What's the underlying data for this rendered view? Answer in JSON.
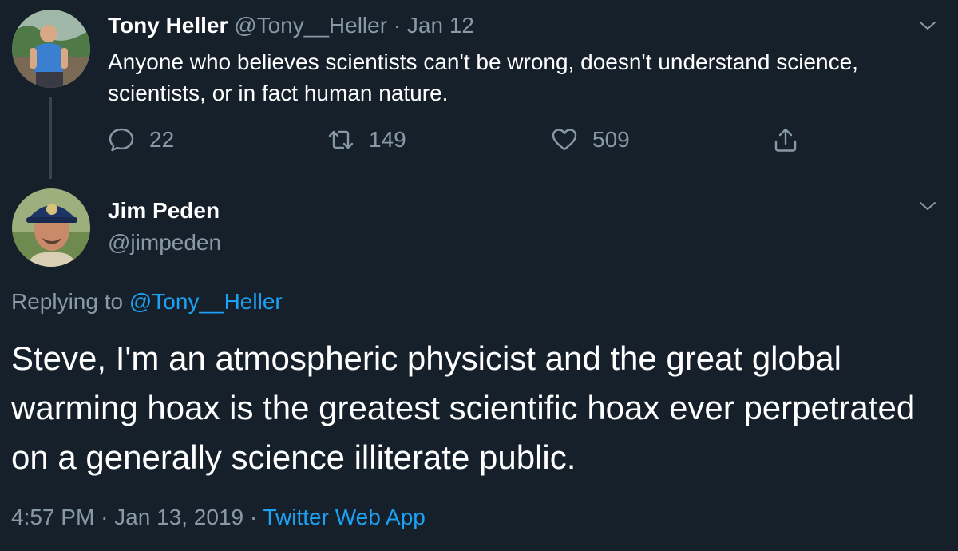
{
  "tweet1": {
    "author_name": "Tony Heller",
    "handle": "@Tony__Heller",
    "separator": "·",
    "date": "Jan 12",
    "text": "Anyone who believes scientists can't be wrong, doesn't understand science, scientists, or in fact human nature.",
    "actions": {
      "reply_count": "22",
      "retweet_count": "149",
      "like_count": "509"
    },
    "icons": {
      "reply": "reply-icon",
      "retweet": "retweet-icon",
      "like": "heart-icon",
      "share": "share-icon",
      "menu": "chevron-down-icon"
    }
  },
  "tweet2": {
    "author_name": "Jim Peden",
    "handle": "@jimpeden",
    "replying_prefix": "Replying to",
    "replying_to": "@Tony__Heller",
    "text": "Steve, I'm an atmospheric physicist and the great global warming hoax is the greatest scientific hoax ever perpetrated on a generally science illiterate public.",
    "time": "4:57 PM",
    "separator1": "·",
    "date": "Jan 13, 2019",
    "separator2": "·",
    "source": "Twitter Web App"
  },
  "colors": {
    "background": "#15202b",
    "text": "#ffffff",
    "muted": "#8899a6",
    "link": "#1da1f2",
    "thread_line": "#38444d"
  }
}
